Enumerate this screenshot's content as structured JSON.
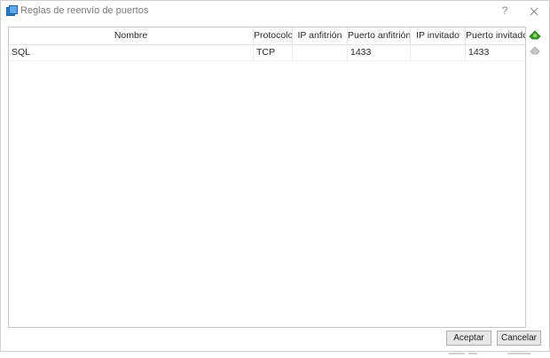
{
  "window": {
    "title": "Reglas de reenvío de puertos",
    "help_label": "?"
  },
  "icons": {
    "app": "port-forwarding-icon",
    "help": "help-icon",
    "close": "close-icon",
    "add": "add-rule-icon",
    "remove": "remove-rule-icon"
  },
  "table": {
    "columns": [
      "Nombre",
      "Protocolo",
      "IP anfitrión",
      "Puerto anfitrión",
      "IP invitado",
      "Puerto invitado"
    ],
    "rows": [
      {
        "name": "SQL",
        "protocol": "TCP",
        "host_ip": "",
        "host_port": "1433",
        "guest_ip": "",
        "guest_port": "1433"
      }
    ]
  },
  "buttons": {
    "accept": "Aceptar",
    "cancel": "Cancelar"
  },
  "colors": {
    "add_icon": "#3a9a2a",
    "remove_icon": "#b8b8b8",
    "app_icon": "#2f7fd0"
  }
}
